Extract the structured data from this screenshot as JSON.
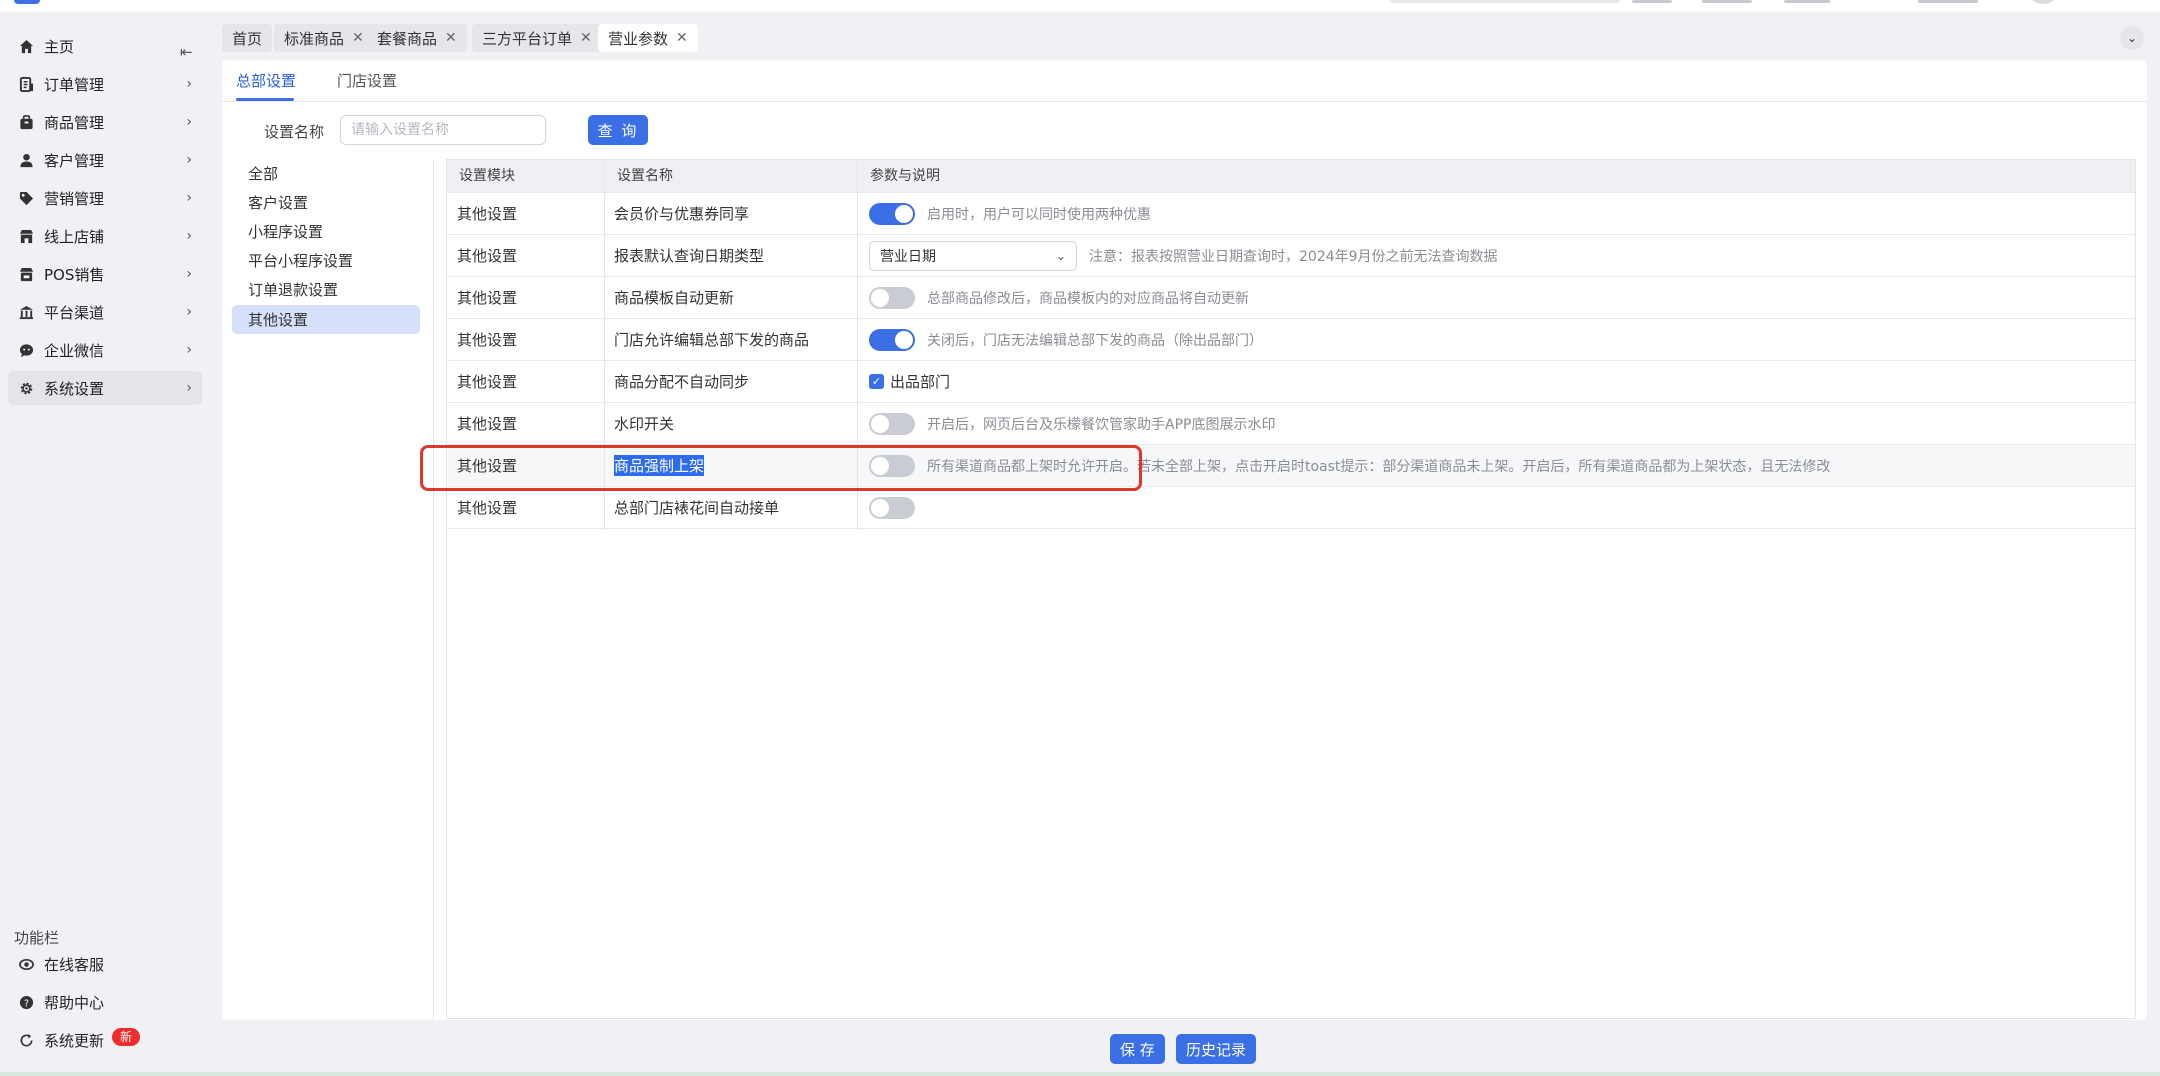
{
  "sidebar": {
    "items": [
      {
        "label": "主页",
        "icon": "home-icon"
      },
      {
        "label": "订单管理",
        "icon": "order-icon"
      },
      {
        "label": "商品管理",
        "icon": "product-icon"
      },
      {
        "label": "客户管理",
        "icon": "user-icon"
      },
      {
        "label": "营销管理",
        "icon": "tag-icon"
      },
      {
        "label": "线上店铺",
        "icon": "store-icon"
      },
      {
        "label": "POS销售",
        "icon": "pos-icon"
      },
      {
        "label": "平台渠道",
        "icon": "channel-icon"
      },
      {
        "label": "企业微信",
        "icon": "wechat-icon"
      },
      {
        "label": "系统设置",
        "icon": "gear-icon"
      }
    ],
    "func_title": "功能栏",
    "func_items": [
      {
        "label": "在线客服",
        "icon": "eye-icon"
      },
      {
        "label": "帮助中心",
        "icon": "help-icon"
      },
      {
        "label": "系统更新",
        "icon": "refresh-icon"
      }
    ],
    "new_badge": "新"
  },
  "tabs": [
    {
      "label": "首页"
    },
    {
      "label": "标准商品"
    },
    {
      "label": "套餐商品"
    },
    {
      "label": "三方平台订单"
    },
    {
      "label": "营业参数"
    }
  ],
  "sub_tabs": [
    {
      "label": "总部设置"
    },
    {
      "label": "门店设置"
    }
  ],
  "search": {
    "label": "设置名称",
    "placeholder": "请输入设置名称",
    "button": "查 询"
  },
  "categories": [
    "全部",
    "客户设置",
    "小程序设置",
    "平台小程序设置",
    "订单退款设置",
    "其他设置"
  ],
  "table": {
    "headers": [
      "设置模块",
      "设置名称",
      "参数与说明"
    ],
    "rows": [
      {
        "module": "其他设置",
        "name": "会员价与优惠券同享",
        "switch_on": true,
        "desc": "启用时，用户可以同时使用两种优惠"
      },
      {
        "module": "其他设置",
        "name": "报表默认查询日期类型",
        "select_value": "营业日期",
        "desc": "注意：报表按照营业日期查询时，2024年9月份之前无法查询数据"
      },
      {
        "module": "其他设置",
        "name": "商品模板自动更新",
        "switch_on": false,
        "desc": "总部商品修改后，商品模板内的对应商品将自动更新"
      },
      {
        "module": "其他设置",
        "name": "门店允许编辑总部下发的商品",
        "switch_on": true,
        "desc": "关闭后，门店无法编辑总部下发的商品（除出品部门）"
      },
      {
        "module": "其他设置",
        "name": "商品分配不自动同步",
        "checkbox_label": "出品部门"
      },
      {
        "module": "其他设置",
        "name": "水印开关",
        "switch_on": false,
        "desc": "开启后，网页后台及乐檬餐饮管家助手APP底图展示水印"
      },
      {
        "module": "其他设置",
        "name": "商品强制上架",
        "switch_on": false,
        "desc": "所有渠道商品都上架时允许开启。若未全部上架，点击开启时toast提示：部分渠道商品未上架。开启后，所有渠道商品都为上架状态，且无法修改"
      },
      {
        "module": "其他设置",
        "name": "总部门店裱花间自动接单",
        "switch_on": false
      }
    ]
  },
  "footer": {
    "save": "保 存",
    "history": "历史记录"
  },
  "colors": {
    "accent": "#3b6fe5",
    "highlight_border": "#e0352b",
    "badge": "#f02d2d"
  }
}
